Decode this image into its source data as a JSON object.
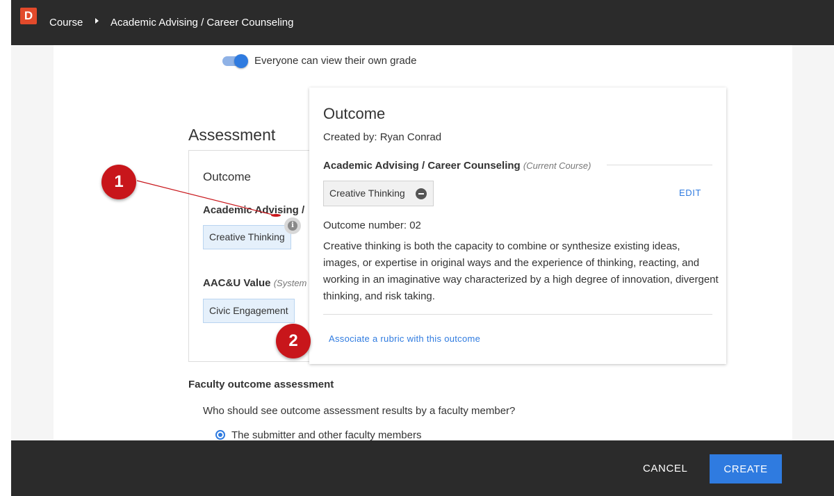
{
  "header": {
    "logo_letter": "D",
    "breadcrumb": [
      "Course",
      "Academic Advising / Career Counseling"
    ]
  },
  "grade_toggle": {
    "label": "Everyone can view their own grade",
    "on": true
  },
  "assessment": {
    "heading": "Assessment",
    "card": {
      "outcome_label": "Outcome",
      "course_name": "Academic Advising /",
      "outcome_chip": "Creative Thinking",
      "aac_label": "AAC&U Value",
      "aac_note": "(System",
      "aac_chip": "Civic Engagement"
    }
  },
  "popover": {
    "title": "Outcome",
    "created_by": "Created by: Ryan Conrad",
    "course": "Academic Advising / Career Counseling",
    "course_note": "(Current Course)",
    "chip_label": "Creative Thinking",
    "edit_label": "EDIT",
    "outcome_number": "Outcome number: 02",
    "description": "Creative thinking is both the capacity to combine or synthesize existing ideas, images, or expertise in original ways and the experience of thinking, reacting, and working in an imaginative way characterized by a high degree of innovation, divergent thinking, and risk taking.",
    "associate_link": "Associate a rubric with this outcome"
  },
  "faculty": {
    "heading": "Faculty outcome assessment",
    "question": "Who should see outcome assessment results by a faculty member?",
    "selected_option": "The submitter and other faculty members"
  },
  "annotations": [
    "1",
    "2"
  ],
  "footer": {
    "cancel_label": "CANCEL",
    "create_label": "CREATE"
  },
  "colors": {
    "accent": "#2f7be0",
    "topbar": "#2b2b2b",
    "annotation": "#c8161b",
    "logo": "#e24a2b"
  }
}
